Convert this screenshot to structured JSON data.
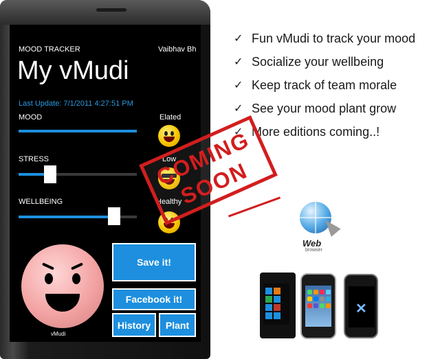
{
  "app": {
    "section_title": "MOOD TRACKER",
    "user_name": "Vaibhav Bh",
    "page_title": "My vMudi",
    "last_update": "Last Update: 7/1/2011 4:27:51 PM"
  },
  "meters": [
    {
      "label": "MOOD",
      "level": "Elated",
      "value": 1.0
    },
    {
      "label": "STRESS",
      "level": "Low",
      "value": 0.27
    },
    {
      "label": "WELLBEING",
      "level": "Healthy",
      "value": 0.81
    }
  ],
  "avatar_caption": "vMudi",
  "buttons": {
    "save": "Save it!",
    "facebook": "Facebook it!",
    "history": "History",
    "plant": "Plant"
  },
  "features": [
    "Fun vMudi to track your mood",
    "Socialize your wellbeing",
    "Keep track of team morale",
    "See your mood plant grow",
    "More editions coming..!"
  ],
  "stamp": {
    "line1": "COMING",
    "line2": "SOON"
  },
  "web_icon": {
    "label": "Web",
    "sublabel": "browser"
  },
  "icons": {
    "check": "check-icon",
    "globe": "globe-icon",
    "cursor": "cursor-icon"
  },
  "colors": {
    "accent": "#1d8fde",
    "stamp": "#d21e1e",
    "subtle_text": "#2a9ae0"
  }
}
